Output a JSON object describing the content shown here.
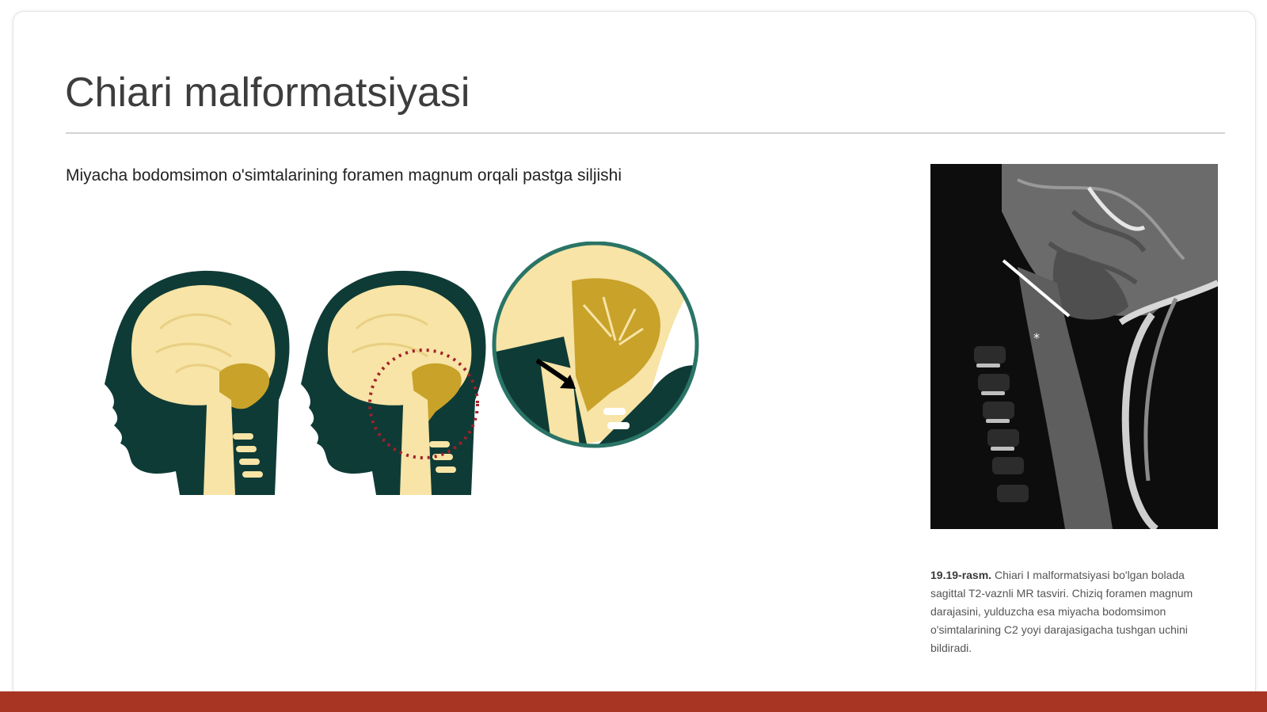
{
  "slide": {
    "title": "Chiari malformatsiyasi",
    "subtitle": "Miyacha bodomsimon o'simtalarining foramen magnum orqali pastga siljishi",
    "caption": {
      "label": "19.19-rasm.",
      "text": "Chiari I malformatsiyasi bo'lgan bolada sagittal T2-vaznli MR tasviri. Chiziq foramen magnum darajasini, yulduzcha esa miyacha bodomsimon o'simtalarining C2 yoyi darajasigacha tushgan uchini bildiradi."
    },
    "mri_marker": "*"
  },
  "colors": {
    "head": "#0f3b36",
    "brain": "#f7e4a6",
    "cerebellum": "#c9a22a",
    "accent_ring": "#2a7466",
    "dotted_ring": "#a3202a",
    "footer": "#a83424"
  }
}
